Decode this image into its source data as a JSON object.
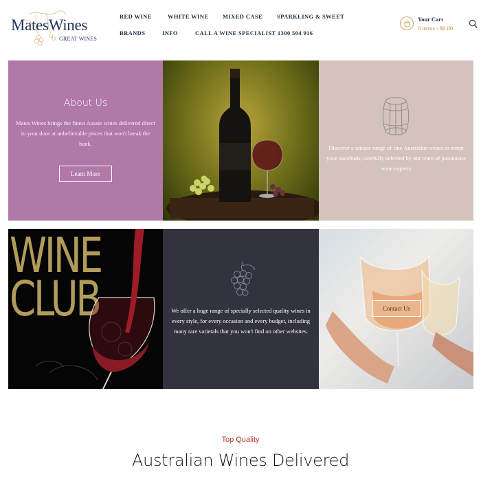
{
  "header": {
    "logo_title": "MatesWines",
    "logo_subtitle": "GREAT WINES",
    "nav": [
      "RED WINE",
      "WHITE WINE",
      "MIXED CASE",
      "SPARKLING & SWEET",
      "BRANDS",
      "INFO",
      "CALL A WINE SPECIALIST 1300 504 916"
    ],
    "cart": {
      "title": "Your Cart",
      "summary": "0 items - $0.00"
    },
    "icons": {
      "cart": "shopping-bag-icon",
      "search": "search-icon"
    }
  },
  "tiles": {
    "about": {
      "title": "About Us",
      "text": "Mates Wines brings the finest Aussie wines delivered direct to your door at unbelievable prices that won't break the bank.",
      "button": "Learn More",
      "color": "#b079a8"
    },
    "photo_bottle": {
      "alt": "wine-bottle-photo"
    },
    "discover": {
      "text": "Discover a unique range of fine Australian wines to tempt your tastebuds, carefully selected by our team of passionate wine experts",
      "icon": "barrel-icon",
      "color": "#d4c2bc"
    },
    "wine_club": {
      "line1": "WINE",
      "line2": "CLUB",
      "color": "#b19c5c"
    },
    "range": {
      "text": "We offer a huge range of specially selected quality wines in every style, for every occasion and every budget, including many rare varietals that you won't find on other websites.",
      "icon": "grapes-icon",
      "color": "#33323f"
    },
    "contact": {
      "button": "Contact Us"
    }
  },
  "section": {
    "eyebrow": "Top Quality",
    "title": "Australian Wines Delivered",
    "eyebrow_color": "#c0392b"
  }
}
